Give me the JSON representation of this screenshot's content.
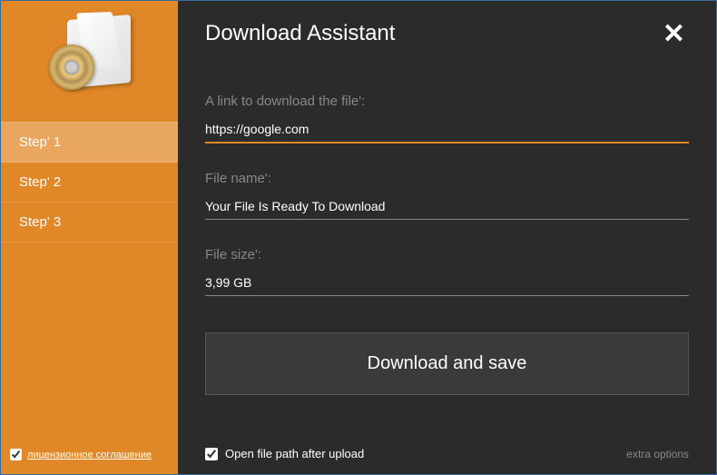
{
  "header": {
    "title": "Download Assistant"
  },
  "sidebar": {
    "steps": [
      {
        "label": "Step' 1",
        "active": true
      },
      {
        "label": "Step' 2",
        "active": false
      },
      {
        "label": "Step' 3",
        "active": false
      }
    ],
    "license": {
      "checked": true,
      "label": "лицензионное соглашение"
    }
  },
  "form": {
    "link": {
      "label": "A link to download the file':",
      "value": "https://google.com"
    },
    "filename": {
      "label": "File name':",
      "value": "Your File Is Ready To Download"
    },
    "filesize": {
      "label": "File size':",
      "value": "3,99 GB"
    },
    "download_button": "Download and save"
  },
  "bottom": {
    "open_path": {
      "checked": true,
      "label": "Open file path after upload"
    },
    "extra_options": "extra options"
  }
}
